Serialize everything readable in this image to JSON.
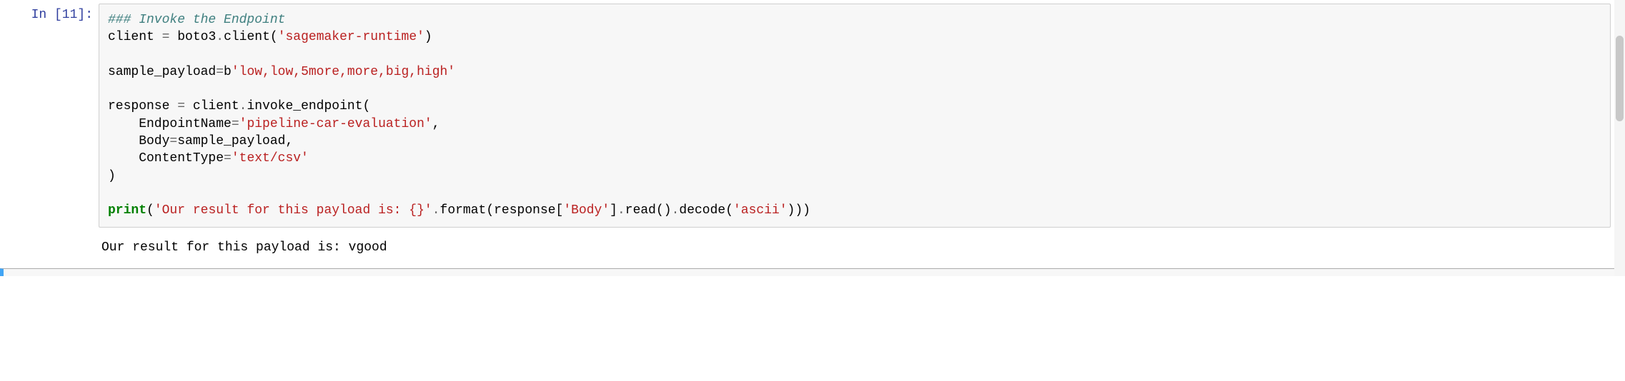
{
  "prompt": {
    "label": "In [11]:"
  },
  "code": {
    "l1_comment": "### Invoke the Endpoint",
    "l2_a": "client ",
    "l2_op": "=",
    "l2_b": " boto3",
    "l2_dot": ".",
    "l2_c": "client(",
    "l2_str": "'sagemaker-runtime'",
    "l2_d": ")",
    "l3": "",
    "l4_a": "sample_payload",
    "l4_op": "=",
    "l4_b": "b",
    "l4_str": "'low,low,5more,more,big,high'",
    "l5": "",
    "l6_a": "response ",
    "l6_op": "=",
    "l6_b": " client",
    "l6_dot": ".",
    "l6_c": "invoke_endpoint(",
    "l7_a": "    EndpointName",
    "l7_op": "=",
    "l7_str": "'pipeline-car-evaluation'",
    "l7_c": ",",
    "l8_a": "    Body",
    "l8_op": "=",
    "l8_b": "sample_payload,",
    "l9_a": "    ContentType",
    "l9_op": "=",
    "l9_str": "'text/csv'",
    "l10": ")",
    "l11": "",
    "l12_kw": "print",
    "l12_p1": "(",
    "l12_str1": "'Our result for this payload is: {}'",
    "l12_dot": ".",
    "l12_a": "format(response[",
    "l12_str2": "'Body'",
    "l12_b": "]",
    "l12_dot2": ".",
    "l12_c": "read()",
    "l12_dot3": ".",
    "l12_d": "decode(",
    "l12_str3": "'ascii'",
    "l12_e": ")))"
  },
  "output": "Our result for this payload is: vgood"
}
